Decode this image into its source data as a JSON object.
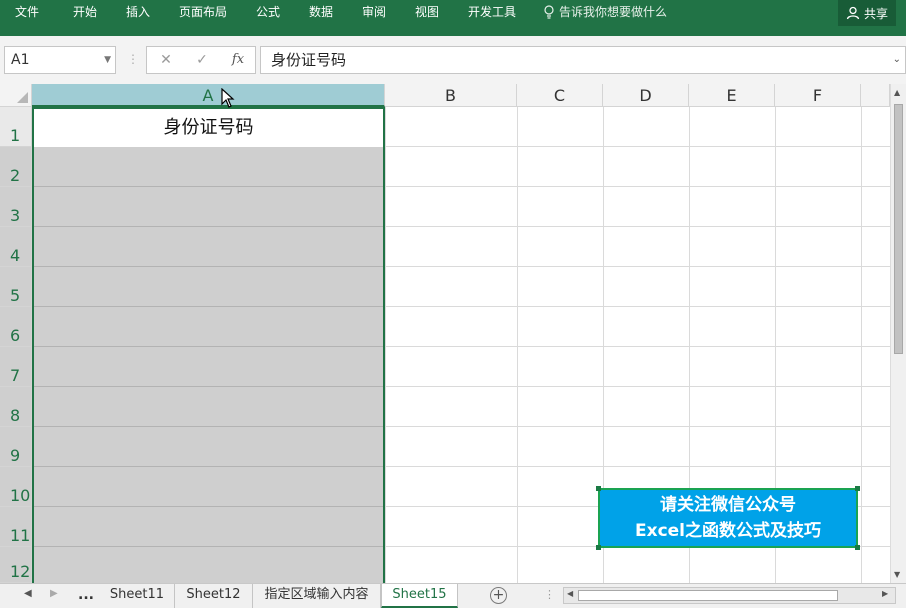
{
  "ribbon": {
    "tabs": [
      "文件",
      "开始",
      "插入",
      "页面布局",
      "公式",
      "数据",
      "审阅",
      "视图",
      "开发工具"
    ],
    "tell_me": "告诉我你想要做什么",
    "share": "共享",
    "accent_color": "#217346"
  },
  "formula_bar": {
    "name_box": "A1",
    "cancel_glyph": "✕",
    "enter_glyph": "✓",
    "fx_label": "fx",
    "content": "身份证号码"
  },
  "grid": {
    "columns": [
      "A",
      "B",
      "C",
      "D",
      "E",
      "F"
    ],
    "rows": [
      "1",
      "2",
      "3",
      "4",
      "5",
      "6",
      "7",
      "8",
      "9",
      "10",
      "11",
      "12"
    ],
    "selected_column": "A",
    "cell_a1": "身份证号码",
    "selection_fill": "#cfcfcf"
  },
  "promo_box": {
    "line1": "请关注微信公众号",
    "line2": "Excel之函数公式及技巧",
    "background": "#00a2e8"
  },
  "sheet_tabs": {
    "ellipsis": "...",
    "tabs": [
      "Sheet11",
      "Sheet12",
      "指定区域输入内容",
      "Sheet15"
    ],
    "active": "Sheet15",
    "add_glyph": "+"
  }
}
